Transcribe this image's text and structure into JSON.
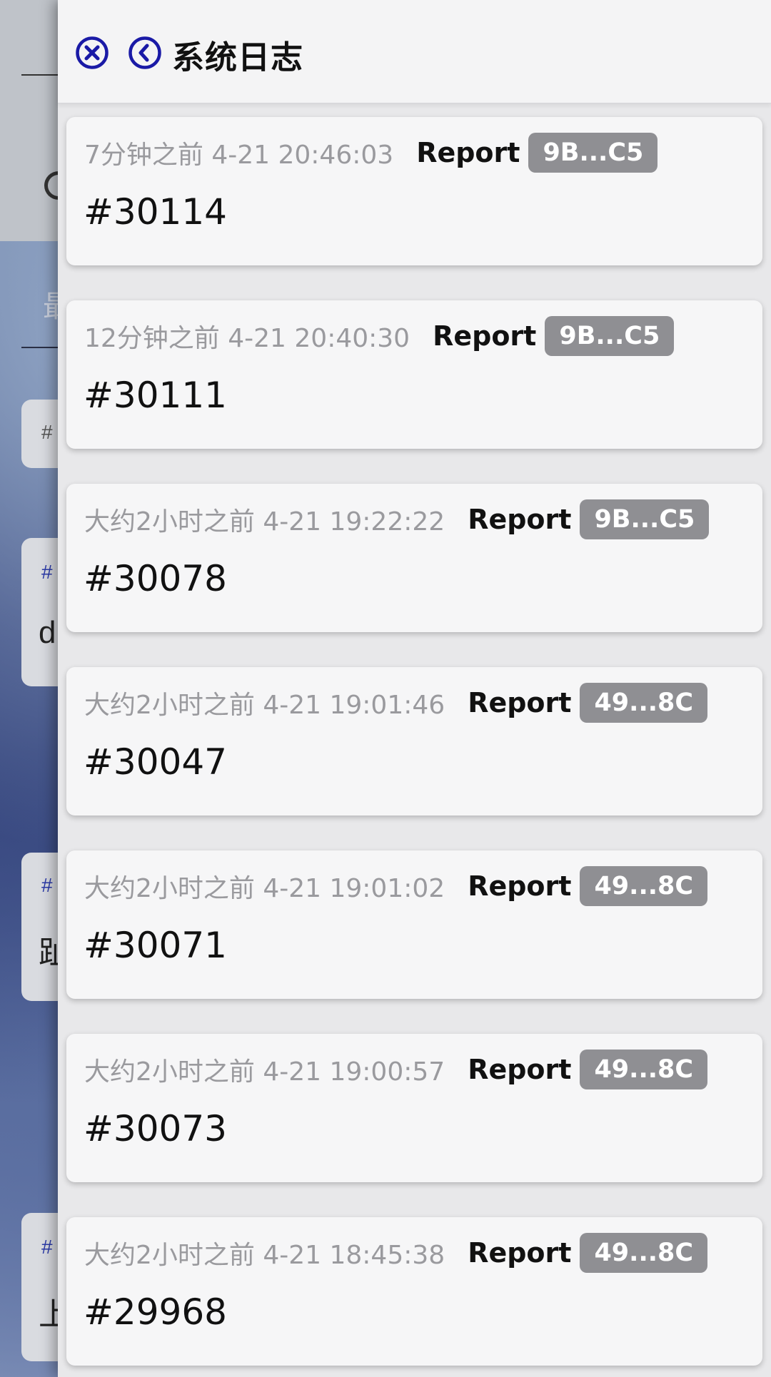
{
  "header": {
    "title": "系统日志",
    "close_icon": "close-circle-icon",
    "back_icon": "back-circle-icon",
    "accent": "#1a1aa6"
  },
  "logs": [
    {
      "time": "7分钟之前 4-21 20:46:03",
      "type": "Report",
      "badge": "9B...C5",
      "id": "#30114"
    },
    {
      "time": "12分钟之前 4-21 20:40:30",
      "type": "Report",
      "badge": "9B...C5",
      "id": "#30111"
    },
    {
      "time": "大约2小时之前 4-21 19:22:22",
      "type": "Report",
      "badge": "9B...C5",
      "id": "#30078"
    },
    {
      "time": "大约2小时之前 4-21 19:01:46",
      "type": "Report",
      "badge": "49...8C",
      "id": "#30047"
    },
    {
      "time": "大约2小时之前 4-21 19:01:02",
      "type": "Report",
      "badge": "49...8C",
      "id": "#30071"
    },
    {
      "time": "大约2小时之前 4-21 19:00:57",
      "type": "Report",
      "badge": "49...8C",
      "id": "#30073"
    },
    {
      "time": "大约2小时之前 4-21 18:45:38",
      "type": "Report",
      "badge": "49...8C",
      "id": "#29968"
    }
  ],
  "background": {
    "tab_text": "最",
    "cards": [
      {
        "hash": "#",
        "letter": ""
      },
      {
        "hash": "#",
        "letter": "d"
      },
      {
        "hash": "#",
        "letter": "趾"
      },
      {
        "hash": "#",
        "letter": "上"
      }
    ]
  }
}
